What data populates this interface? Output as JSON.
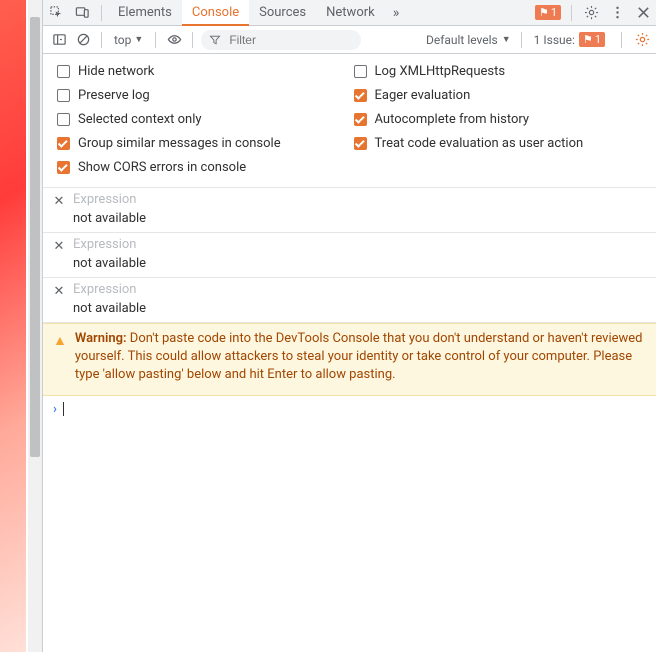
{
  "topbar": {
    "tabs": {
      "elements": "Elements",
      "console": "Console",
      "sources": "Sources",
      "network": "Network"
    },
    "error_count": "1"
  },
  "toolbar": {
    "context_label": "top",
    "filter_placeholder": "Filter",
    "levels_label": "Default levels",
    "issues_prefix": "1 Issue:",
    "issues_count": "1"
  },
  "settings": {
    "left": [
      {
        "label": "Hide network",
        "checked": false
      },
      {
        "label": "Preserve log",
        "checked": false
      },
      {
        "label": "Selected context only",
        "checked": false
      },
      {
        "label": "Group similar messages in console",
        "checked": true
      },
      {
        "label": "Show CORS errors in console",
        "checked": true
      }
    ],
    "right": [
      {
        "label": "Log XMLHttpRequests",
        "checked": false
      },
      {
        "label": "Eager evaluation",
        "checked": true
      },
      {
        "label": "Autocomplete from history",
        "checked": true
      },
      {
        "label": "Treat code evaluation as user action",
        "checked": true
      }
    ]
  },
  "live_expressions": [
    {
      "label": "Expression",
      "value": "not available"
    },
    {
      "label": "Expression",
      "value": "not available"
    },
    {
      "label": "Expression",
      "value": "not available"
    }
  ],
  "warning": {
    "title": "Warning: ",
    "body": "Don't paste code into the DevTools Console that you don't understand or haven't reviewed yourself. This could allow attackers to steal your identity or take control of your computer. Please type 'allow pasting' below and hit Enter to allow pasting."
  }
}
